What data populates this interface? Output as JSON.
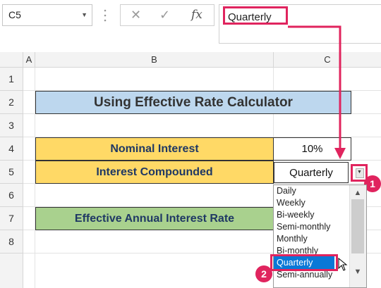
{
  "name_box": {
    "value": "C5"
  },
  "formula_bar": {
    "cancel_icon": "✕",
    "enter_icon": "✓",
    "fx_label": "fx",
    "value": "Quarterly"
  },
  "columns": [
    "A",
    "B",
    "C"
  ],
  "rows": [
    "1",
    "2",
    "3",
    "4",
    "5",
    "6",
    "7",
    "8"
  ],
  "sheet": {
    "title": "Using Effective Rate Calculator",
    "nominal_label": "Nominal Interest",
    "nominal_value": "10%",
    "compounded_label": "Interest Compounded",
    "compounded_value": "Quarterly",
    "effective_label": "Effective Annual Interest Rate"
  },
  "dropdown": {
    "items": [
      "Daily",
      "Weekly",
      "Bi-weekly",
      "Semi-monthly",
      "Monthly",
      "Bi-monthly",
      "Quarterly",
      "Semi-annually"
    ],
    "selected": "Quarterly"
  },
  "badges": {
    "step1": "1",
    "step2": "2"
  },
  "colors": {
    "accent": "#e0245e",
    "title_fill": "#bdd7ee",
    "label_fill": "#ffd966",
    "result_fill": "#a9d18e",
    "selection": "#0a78d7"
  }
}
